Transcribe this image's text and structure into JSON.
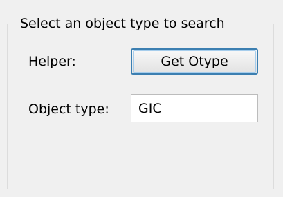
{
  "group": {
    "legend": "Select an object type to search"
  },
  "helper": {
    "label": "Helper:",
    "button_label": "Get Otype"
  },
  "object_type": {
    "label": "Object type:",
    "value": "GIC",
    "placeholder": ""
  }
}
